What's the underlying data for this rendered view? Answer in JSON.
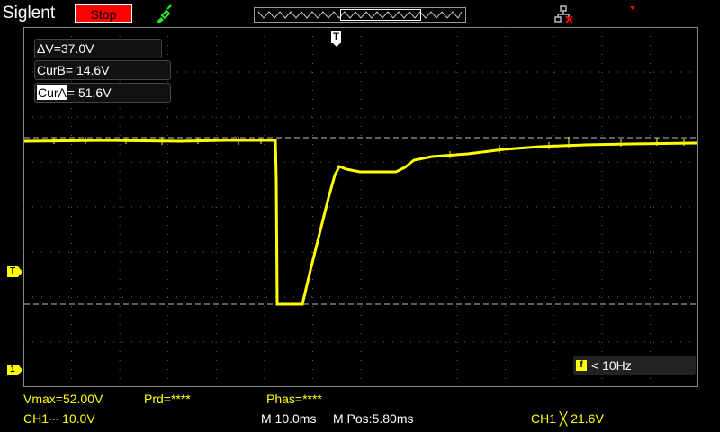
{
  "header": {
    "brand": "Siglent",
    "stop_label": "Stop",
    "run_icon": "probe-icon",
    "usb_icon": "usb-disconnected-icon"
  },
  "cursors": {
    "delta": "ΔV=37.0V",
    "curB_label": "CurB",
    "curB_value": "= 14.6V",
    "curA_label": "CurA",
    "curA_value": "= 51.6V"
  },
  "markers": {
    "trigger_top": "T",
    "trigger_level": "T",
    "channel1": "1"
  },
  "frequency": {
    "icon": "f",
    "text": "< 10Hz"
  },
  "measurements": {
    "vmax": "Vmax=52.00V",
    "prd": "Prd=****",
    "phas": "Phas=****"
  },
  "status": {
    "ch1_scale": "CH1⎓ 10.0V",
    "timebase": "M 10.0ms",
    "mpos": "M Pos:5.80ms",
    "trigger": "CH1 ╳ 21.6V"
  },
  "colors": {
    "trace": "#ffff00",
    "grid": "#666666",
    "stop": "#ff0000"
  }
}
